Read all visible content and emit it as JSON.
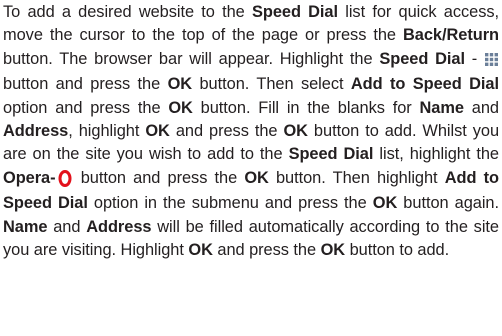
{
  "icons": {
    "speed_dial": "speed-dial-grid-icon",
    "opera": "opera-o-icon"
  },
  "colors": {
    "text": "#231f20",
    "opera_red": "#e3111c",
    "grid_icon": "#6b7f99"
  },
  "paragraph": {
    "s1a": "To add a desired website to the ",
    "s1b": "Speed Dial",
    "s1c": " list for quick access, move the cursor to the top of the page or press the ",
    "s1d": "Back/Return",
    "s1e": " button. The browser bar will appear. Highlight the ",
    "s1f": "Speed Dial",
    "s1g": " - ",
    "s1h": " button and press the ",
    "s1i": "OK",
    "s1j": " button. Then select ",
    "s1k": "Add to Speed Dial",
    "s1l": " option and press the ",
    "s1m": "OK",
    "s1n": " button. Fill in the blanks for ",
    "s1o": "Name",
    "s1p": " and ",
    "s1q": "Address",
    "s1r": ", highlight ",
    "s1s": "OK",
    "s1t": " and press the ",
    "s1u": "OK",
    "s1v": " button to add. Whilst you are on the site you wish to add to the ",
    "s1w": "Speed Dial",
    "s1x": " list, highlight the ",
    "s1y": "Opera-",
    "s1z": " button and press the ",
    "s2a": "OK",
    "s2b": " button. Then highlight ",
    "s2c": "Add to Speed Dial",
    "s2d": " option in the submenu and press the ",
    "s2e": "OK",
    "s2f": " button again. ",
    "s2g": "Name",
    "s2h": " and ",
    "s2i": "Address",
    "s2j": " will be filled automatically according to the site you are visiting. Highlight ",
    "s2k": "OK",
    "s2l": " and press the ",
    "s2m": "OK",
    "s2n": " button to add."
  }
}
